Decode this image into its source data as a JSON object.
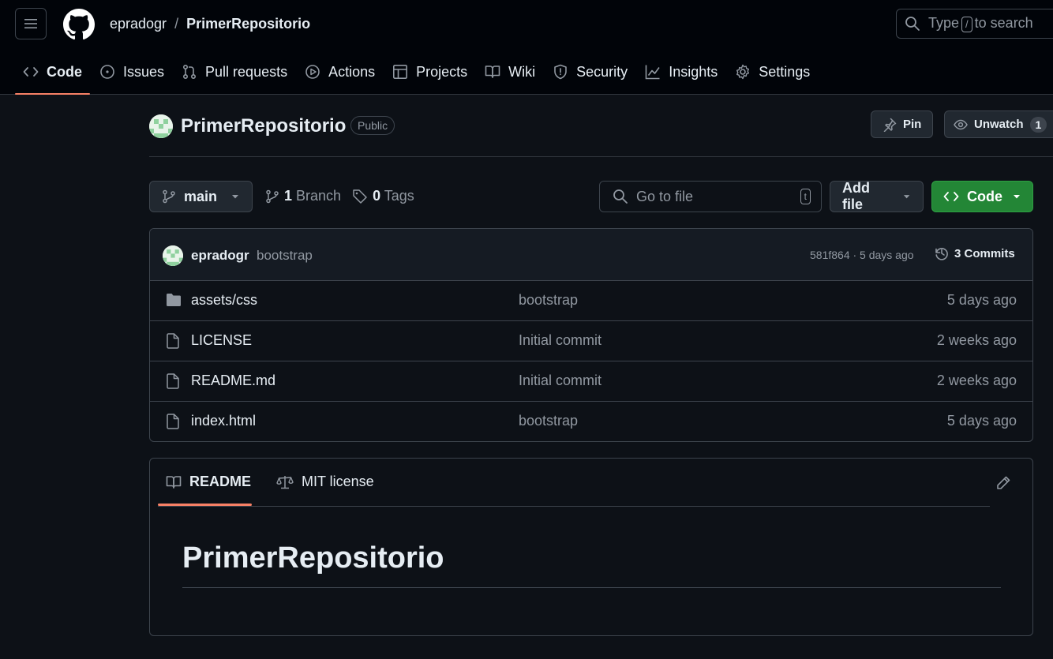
{
  "header": {
    "owner": "epradogr",
    "separator": "/",
    "repo": "PrimerRepositorio",
    "search": {
      "before": "Type",
      "key": "/",
      "after": "to search"
    }
  },
  "nav_tabs": [
    {
      "label": "Code",
      "icon": "code-icon",
      "active": true
    },
    {
      "label": "Issues",
      "icon": "issue-icon"
    },
    {
      "label": "Pull requests",
      "icon": "pull-request-icon"
    },
    {
      "label": "Actions",
      "icon": "play-icon"
    },
    {
      "label": "Projects",
      "icon": "table-icon"
    },
    {
      "label": "Wiki",
      "icon": "book-icon"
    },
    {
      "label": "Security",
      "icon": "shield-icon"
    },
    {
      "label": "Insights",
      "icon": "graph-icon"
    },
    {
      "label": "Settings",
      "icon": "gear-icon"
    }
  ],
  "repo_header": {
    "title": "PrimerRepositorio",
    "visibility": "Public",
    "pin_label": "Pin",
    "unwatch_label": "Unwatch",
    "watch_count": "1"
  },
  "toolbar": {
    "branch": "main",
    "branch_count": "1",
    "branch_label": "Branch",
    "tag_count": "0",
    "tag_label": "Tags",
    "goto_placeholder": "Go to file",
    "goto_key": "t",
    "add_file_label": "Add file",
    "code_label": "Code"
  },
  "latest_commit": {
    "author": "epradogr",
    "message": "bootstrap",
    "meta": "581f864 · 5 days ago",
    "commits_label": "3 Commits"
  },
  "files": [
    {
      "name": "assets/css",
      "type": "folder",
      "message": "bootstrap",
      "date": "5 days ago"
    },
    {
      "name": "LICENSE",
      "type": "file",
      "message": "Initial commit",
      "date": "2 weeks ago"
    },
    {
      "name": "README.md",
      "type": "file",
      "message": "Initial commit",
      "date": "2 weeks ago"
    },
    {
      "name": "index.html",
      "type": "file",
      "message": "bootstrap",
      "date": "5 days ago"
    }
  ],
  "readme": {
    "tab_readme": "README",
    "tab_license": "MIT license",
    "heading": "PrimerRepositorio"
  },
  "colors": {
    "background": "#0d1117",
    "header_bg": "#010409",
    "accent_underline": "#f78166",
    "code_button": "#238636",
    "border": "#3d444d",
    "muted_text": "#9198a1"
  }
}
